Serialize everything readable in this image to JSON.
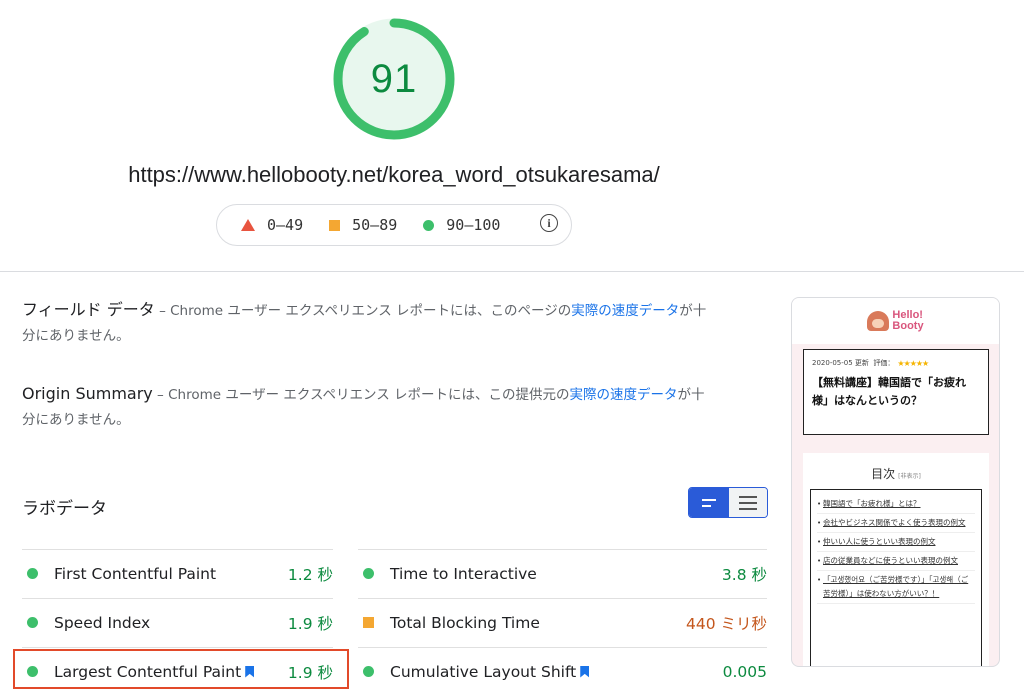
{
  "score": {
    "value": "91",
    "fraction": 0.91,
    "color": "#0c8a3f"
  },
  "url": "https://www.hellobooty.net/korea_word_otsukaresama/",
  "legend": {
    "ranges": [
      "0–49",
      "50–89",
      "90–100"
    ],
    "info_icon": "info-icon"
  },
  "field_data": {
    "title": "フィールド データ",
    "sep": " – ",
    "text_prefix": "Chrome ユーザー エクスペリエンス レポートには、このページの",
    "link": "実際の速度データ",
    "text_suffix": "が十分にありません。"
  },
  "origin_summary": {
    "title": "Origin Summary",
    "sep": " – ",
    "text_prefix": "Chrome ユーザー エクスペリエンス レポートには、この提供元の",
    "link": "実際の速度データ",
    "text_suffix": "が十分にありません。"
  },
  "lab_data": {
    "title": "ラボデータ"
  },
  "metrics": {
    "fcp": {
      "name": "First Contentful Paint",
      "value": "1.2 秒"
    },
    "si": {
      "name": "Speed Index",
      "value": "1.9 秒"
    },
    "lcp": {
      "name": "Largest Contentful Paint",
      "value": "1.9 秒"
    },
    "tti": {
      "name": "Time to Interactive",
      "value": "3.8 秒"
    },
    "tbt": {
      "name": "Total Blocking Time",
      "value": "440 ミリ秒"
    },
    "cls": {
      "name": "Cumulative Layout Shift",
      "value": "0.005"
    }
  },
  "phone": {
    "logo_line1": "Hello!",
    "logo_line2": "Booty",
    "meta_date": "2020-05-05 更新",
    "meta_rating": "評価：",
    "stars": "★★★★★",
    "article_title": "【無料講座】韓国語で「お疲れ様」はなんというの？",
    "toc_title": "目次",
    "toc_small": "[非表示]",
    "toc_items": [
      "韓国語で「お疲れ様」とは？",
      "会社やビジネス関係でよく使う表現の例文",
      "仲いい人に使うといい表現の例文",
      "店の従業員などに使うといい表現の例文",
      "「고생했어요（ご苦労様です）」「고생해（ご苦労様）」は使わない方がいい？！"
    ]
  },
  "colors": {
    "good": "#3dbf6b",
    "average": "#f4a732",
    "poor": "#e8543f",
    "link": "#1a73e8",
    "highlight": "#e24a2a"
  }
}
